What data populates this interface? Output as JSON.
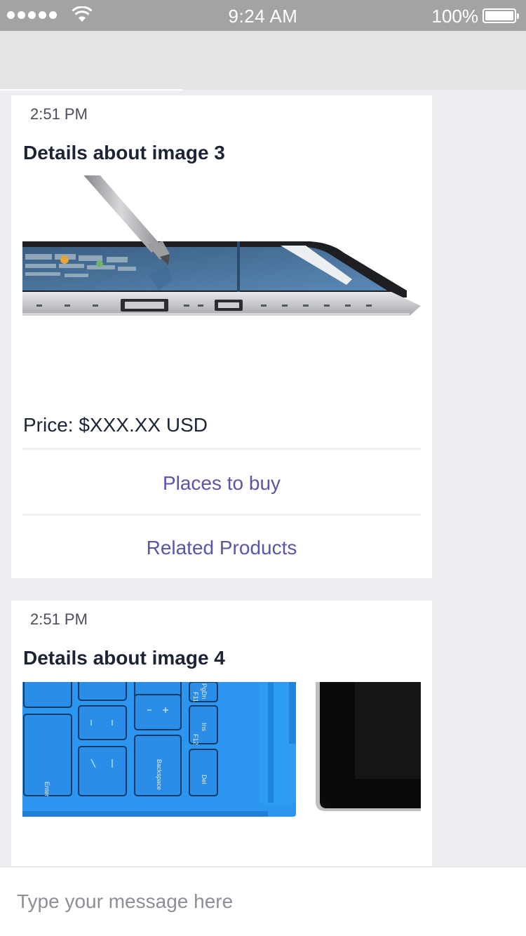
{
  "status_bar": {
    "time": "9:24 AM",
    "battery": "100%"
  },
  "messages": [
    {
      "time": "2:51 PM",
      "title": "Details about image 3",
      "image_icon": "tablet-with-pen-icon",
      "price": "Price: $XXX.XX USD",
      "actions": [
        "Places to buy",
        "Related Products"
      ]
    },
    {
      "time": "2:51 PM",
      "title": "Details about image 4",
      "image_icon": "blue-keyboard-cover-icon",
      "keys": [
        "Enter",
        "Backspace",
        "Del",
        "Ins",
        "F12",
        "PgDn",
        "F11"
      ]
    }
  ],
  "composer": {
    "placeholder": "Type your message here"
  },
  "colors": {
    "link": "#5b55a8",
    "title": "#1c2436",
    "keyboard": "#2b95f0",
    "status_bar": "#a3a3a3"
  }
}
